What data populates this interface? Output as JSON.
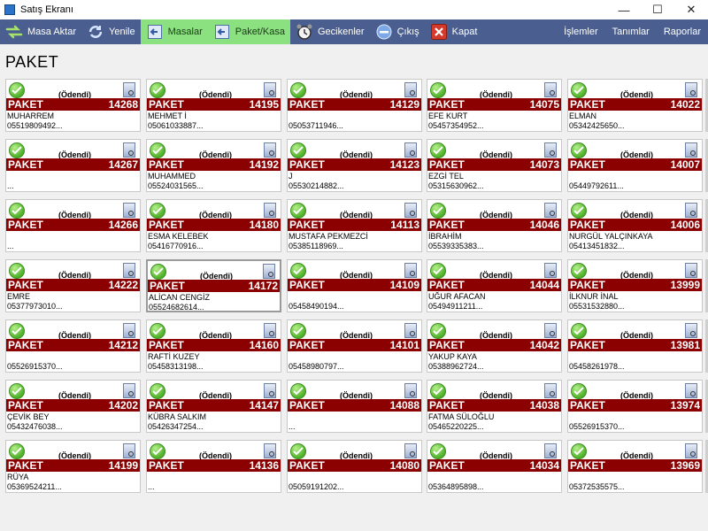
{
  "window": {
    "title": "Satış Ekranı",
    "minimize": "—",
    "maximize": "☐",
    "close": "✕"
  },
  "toolbar": {
    "items": [
      {
        "label": "Masa Aktar",
        "icon": "transfer-arrows-icon",
        "active": false
      },
      {
        "label": "Yenile",
        "icon": "refresh-icon",
        "active": false
      },
      {
        "label": "Masalar",
        "icon": "back-arrow-icon",
        "active": true
      },
      {
        "label": "Paket/Kasa",
        "icon": "back-arrow-icon",
        "active": true
      },
      {
        "label": "Gecikenler",
        "icon": "alarm-clock-icon",
        "active": false
      },
      {
        "label": "Çıkış",
        "icon": "exit-circle-icon",
        "active": false
      },
      {
        "label": "Kapat",
        "icon": "close-red-icon",
        "active": false
      }
    ],
    "right": [
      "İşlemler",
      "Tanımlar",
      "Raporlar"
    ]
  },
  "page_title": "PAKET",
  "cards": [
    [
      {
        "status": "(Ödendi)",
        "label": "PAKET",
        "no": "14268",
        "name": "MUHARREM",
        "phone": "05519809492..."
      },
      {
        "status": "(Ödendi)",
        "label": "PAKET",
        "no": "14195",
        "name": "MEHMET İ",
        "phone": "05061033887..."
      },
      {
        "status": "(Ödendi)",
        "label": "PAKET",
        "no": "14129",
        "name": "",
        "phone": "05053711946..."
      },
      {
        "status": "(Ödendi)",
        "label": "PAKET",
        "no": "14075",
        "name": "EFE KURT",
        "phone": "05457354952..."
      },
      {
        "status": "(Ödendi)",
        "label": "PAKET",
        "no": "14022",
        "name": " ELMAN",
        "phone": "05342425650..."
      }
    ],
    [
      {
        "status": "(Ödendi)",
        "label": "PAKET",
        "no": "14267",
        "name": "",
        "phone": "..."
      },
      {
        "status": "(Ödendi)",
        "label": "PAKET",
        "no": "14192",
        "name": " MUHAMMED",
        "phone": "05524031565..."
      },
      {
        "status": "(Ödendi)",
        "label": "PAKET",
        "no": "14123",
        "name": "J",
        "phone": "05530214882..."
      },
      {
        "status": "(Ödendi)",
        "label": "PAKET",
        "no": "14073",
        "name": "EZGİ TEL",
        "phone": "05315630962..."
      },
      {
        "status": "(Ödendi)",
        "label": "PAKET",
        "no": "14007",
        "name": "",
        "phone": "05449792611..."
      }
    ],
    [
      {
        "status": "(Ödendi)",
        "label": "PAKET",
        "no": "14266",
        "name": "",
        "phone": "..."
      },
      {
        "status": "(Ödendi)",
        "label": "PAKET",
        "no": "14180",
        "name": "ESMA KELEBEK",
        "phone": "05416770916..."
      },
      {
        "status": "(Ödendi)",
        "label": "PAKET",
        "no": "14113",
        "name": "MUSTAFA PEKMEZCİ",
        "phone": "05385118969..."
      },
      {
        "status": "(Ödendi)",
        "label": "PAKET",
        "no": "14046",
        "name": "İBRAHİM",
        "phone": "05539335383..."
      },
      {
        "status": "(Ödendi)",
        "label": "PAKET",
        "no": "14006",
        "name": "NURGÜL YALÇINKAYA",
        "phone": "05413451832..."
      }
    ],
    [
      {
        "status": "(Ödendi)",
        "label": "PAKET",
        "no": "14222",
        "name": "EMRE",
        "phone": "05377973010..."
      },
      {
        "status": "(Ödendi)",
        "label": "PAKET",
        "no": "14172",
        "name": " ALİCAN CENGİZ",
        "phone": "05524682614...",
        "selected": true
      },
      {
        "status": "(Ödendi)",
        "label": "PAKET",
        "no": "14109",
        "name": "",
        "phone": "05458490194..."
      },
      {
        "status": "(Ödendi)",
        "label": "PAKET",
        "no": "14044",
        "name": " UĞUR AFACAN",
        "phone": "05494911211..."
      },
      {
        "status": "(Ödendi)",
        "label": "PAKET",
        "no": "13999",
        "name": " İLKNUR İNAL",
        "phone": "05531532880..."
      }
    ],
    [
      {
        "status": "(Ödendi)",
        "label": "PAKET",
        "no": "14212",
        "name": "",
        "phone": "05526915370..."
      },
      {
        "status": "(Ödendi)",
        "label": "PAKET",
        "no": "14160",
        "name": "RAFTİ KUZEY",
        "phone": "05458313198..."
      },
      {
        "status": "(Ödendi)",
        "label": "PAKET",
        "no": "14101",
        "name": "",
        "phone": "05458980797..."
      },
      {
        "status": "(Ödendi)",
        "label": "PAKET",
        "no": "14042",
        "name": " YAKUP KAYA",
        "phone": "05388962724..."
      },
      {
        "status": "(Ödendi)",
        "label": "PAKET",
        "no": "13981",
        "name": "",
        "phone": "05458261978..."
      }
    ],
    [
      {
        "status": "(Ödendi)",
        "label": "PAKET",
        "no": "14202",
        "name": " ÇEVİK BEY",
        "phone": "05432476038..."
      },
      {
        "status": "(Ödendi)",
        "label": "PAKET",
        "no": "14147",
        "name": "KÜBRA SALKIM",
        "phone": "05426347254..."
      },
      {
        "status": "(Ödendi)",
        "label": "PAKET",
        "no": "14088",
        "name": "",
        "phone": "..."
      },
      {
        "status": "(Ödendi)",
        "label": "PAKET",
        "no": "14038",
        "name": " FATMA SÜLOĞLU",
        "phone": "05465220225..."
      },
      {
        "status": "(Ödendi)",
        "label": "PAKET",
        "no": "13974",
        "name": "",
        "phone": "05526915370..."
      }
    ],
    [
      {
        "status": "(Ödendi)",
        "label": "PAKET",
        "no": "14199",
        "name": "RÜYA",
        "phone": "05369524211..."
      },
      {
        "status": "(Ödendi)",
        "label": "PAKET",
        "no": "14136",
        "name": "",
        "phone": "..."
      },
      {
        "status": "(Ödendi)",
        "label": "PAKET",
        "no": "14080",
        "name": "",
        "phone": "05059191202..."
      },
      {
        "status": "(Ödendi)",
        "label": "PAKET",
        "no": "14034",
        "name": "",
        "phone": "05364895898..."
      },
      {
        "status": "(Ödendi)",
        "label": "PAKET",
        "no": "13969",
        "name": "",
        "phone": "05372535575..."
      }
    ]
  ],
  "colors": {
    "toolbar": "#4a5f8f",
    "active_tab": "#8be07f",
    "paket_bar": "#8b0000",
    "background": "#f0f0f0"
  }
}
